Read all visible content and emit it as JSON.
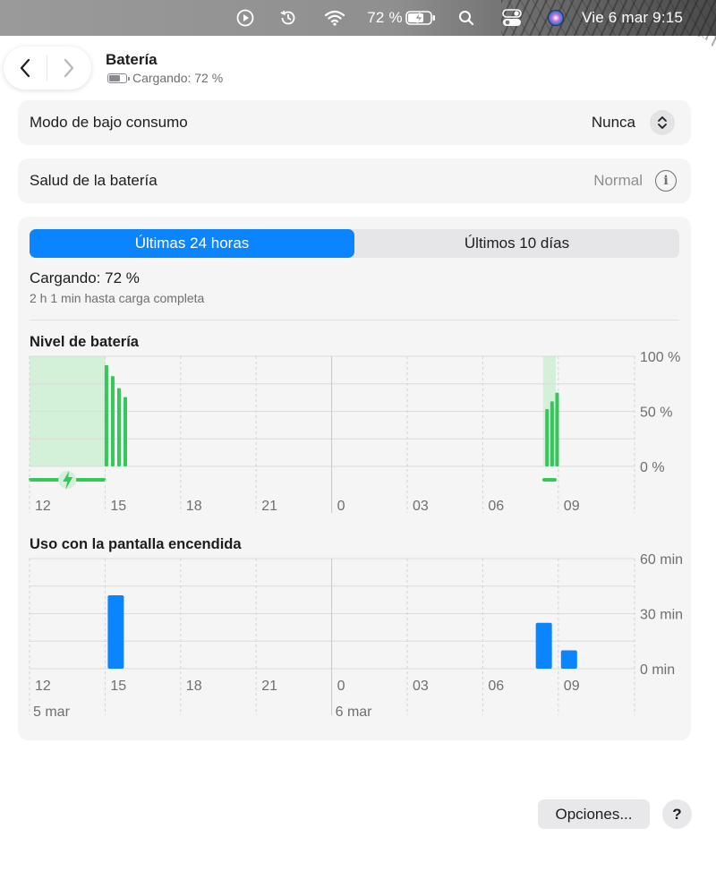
{
  "menubar": {
    "battery_percent": "72 %",
    "datetime": "Vie 6 mar 9:15",
    "icons": [
      "play-icon",
      "time-machine-icon",
      "wifi-icon",
      "battery-charging-icon",
      "search-icon",
      "control-center-icon",
      "siri-icon"
    ]
  },
  "header": {
    "title": "Batería",
    "subtitle": "Cargando: 72 %"
  },
  "low_power": {
    "label": "Modo de bajo consumo",
    "value": "Nunca"
  },
  "health": {
    "label": "Salud de la batería",
    "value": "Normal"
  },
  "tabs": [
    {
      "label": "Últimas 24 horas",
      "active": true
    },
    {
      "label": "Últimos 10 días",
      "active": false
    }
  ],
  "status": {
    "main": "Cargando: 72 %",
    "sub": "2 h 1 min hasta carga completa"
  },
  "chart_data": [
    {
      "type": "bar",
      "title": "Nivel de batería",
      "x_ticks": [
        "12",
        "15",
        "18",
        "21",
        "0",
        "03",
        "06",
        "09"
      ],
      "y_ticks": [
        "100 %",
        "50 %",
        "0 %"
      ],
      "ylim": [
        0,
        100
      ],
      "unit": "%",
      "charging_periods": [
        {
          "start_hour": 12.0,
          "end_hour": 15.0
        },
        {
          "start_hour": 8.4,
          "end_hour": 8.9
        }
      ],
      "bars": [
        {
          "hour": 15.0,
          "value": 92
        },
        {
          "hour": 15.25,
          "value": 82
        },
        {
          "hour": 15.5,
          "value": 71
        },
        {
          "hour": 15.75,
          "value": 63
        },
        {
          "hour": 8.5,
          "value": 52
        },
        {
          "hour": 8.7,
          "value": 59
        },
        {
          "hour": 8.9,
          "value": 67
        }
      ],
      "colors": {
        "bar": "#34c759",
        "charging_fill": "#d3f0d8"
      }
    },
    {
      "type": "bar",
      "title": "Uso con la pantalla encendida",
      "x_ticks": [
        "12",
        "15",
        "18",
        "21",
        "0",
        "03",
        "06",
        "09"
      ],
      "date_labels": [
        "5 mar",
        "6 mar"
      ],
      "y_ticks": [
        "60 min",
        "30 min",
        "0 min"
      ],
      "ylim": [
        0,
        60
      ],
      "unit": "min",
      "bars": [
        {
          "hour": 15.0,
          "value": 40
        },
        {
          "hour": 8.0,
          "value": 25
        },
        {
          "hour": 9.0,
          "value": 10
        }
      ],
      "colors": {
        "bar": "#0a84ff"
      }
    }
  ],
  "footer": {
    "options_label": "Opciones...",
    "help_label": "?"
  }
}
